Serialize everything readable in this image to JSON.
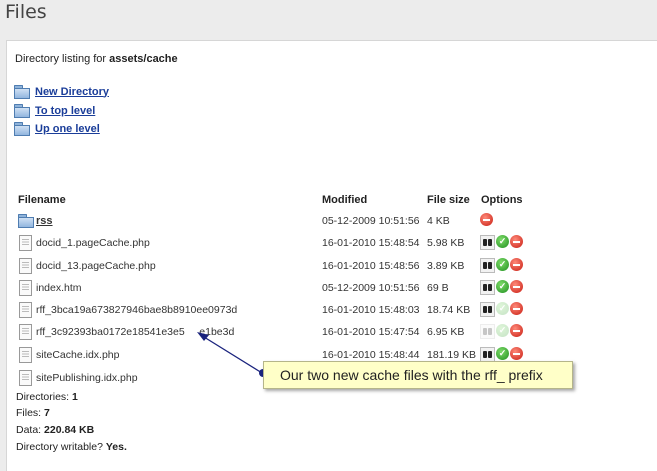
{
  "page": {
    "title": "Files"
  },
  "listing": {
    "prefix": "Directory listing for ",
    "path": "assets/cache"
  },
  "nav": [
    {
      "label": "New Directory",
      "icon": "folder-icon"
    },
    {
      "label": "To top level",
      "icon": "folder-icon"
    },
    {
      "label": "Up one level",
      "icon": "folder-icon"
    }
  ],
  "table": {
    "headers": {
      "filename": "Filename",
      "modified": "Modified",
      "size": "File size",
      "options": "Options"
    },
    "rows": [
      {
        "name": "rss",
        "modified": "05-12-2009 10:51:56",
        "size": "4 KB",
        "type": "folder",
        "options": [
          "delete"
        ]
      },
      {
        "name": "docid_1.pageCache.php",
        "modified": "16-01-2010 15:48:54",
        "size": "5.98 KB",
        "type": "file",
        "options": [
          "view",
          "accept",
          "delete"
        ]
      },
      {
        "name": "docid_13.pageCache.php",
        "modified": "16-01-2010 15:48:56",
        "size": "3.89 KB",
        "type": "file",
        "options": [
          "view",
          "accept",
          "delete"
        ]
      },
      {
        "name": "index.htm",
        "modified": "05-12-2009 10:51:56",
        "size": "69 B",
        "type": "file",
        "options": [
          "view",
          "accept",
          "delete"
        ]
      },
      {
        "name": "rff_3bca19a673827946bae8b8910ee0973d",
        "modified": "16-01-2010 15:48:03",
        "size": "18.74 KB",
        "type": "file",
        "options": [
          "view",
          "accept-disabled",
          "delete"
        ]
      },
      {
        "name": "rff_3c92393ba0172e18541e3e5     e1be3d",
        "modified": "16-01-2010 15:47:54",
        "size": "6.95 KB",
        "type": "file",
        "options": [
          "view-disabled",
          "accept-disabled",
          "delete"
        ]
      },
      {
        "name": "siteCache.idx.php",
        "modified": "16-01-2010 15:48:44",
        "size": "181.19 KB",
        "type": "file",
        "options": [
          "view",
          "accept",
          "delete"
        ]
      },
      {
        "name": "sitePublishing.idx.php",
        "modified": "",
        "size": "",
        "type": "file",
        "options": []
      }
    ]
  },
  "summary": {
    "directories_label": "Directories: ",
    "directories": "1",
    "files_label": "Files: ",
    "files": "7",
    "data_label": "Data: ",
    "data": "220.84 KB",
    "writable_label": "Directory writable? ",
    "writable": "Yes."
  },
  "callout": {
    "text": "Our two new cache files with the rff_ prefix"
  }
}
